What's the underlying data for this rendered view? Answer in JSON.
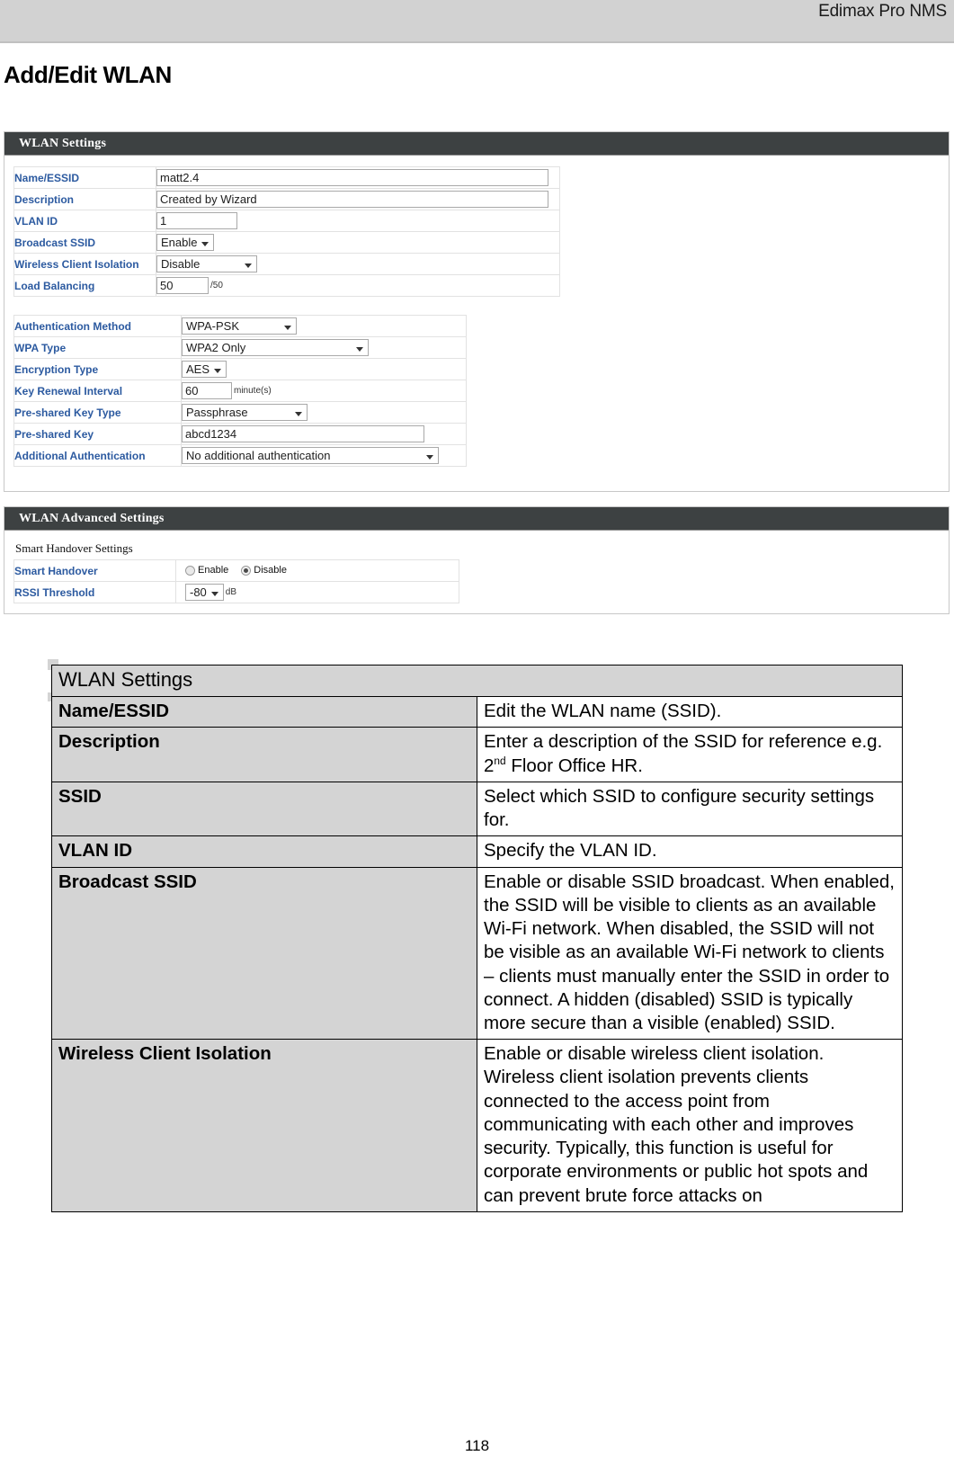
{
  "header": {
    "brand": "Edimax Pro NMS"
  },
  "page": {
    "title": "Add/Edit WLAN",
    "number": "118"
  },
  "wlan_settings_panel": {
    "title": "WLAN Settings",
    "basic_rows": [
      {
        "label": "Name/ESSID",
        "control": "text",
        "value": "matt2.4"
      },
      {
        "label": "Description",
        "control": "text",
        "value": "Created by Wizard"
      },
      {
        "label": "VLAN ID",
        "control": "text",
        "value": "1"
      },
      {
        "label": "Broadcast SSID",
        "control": "select",
        "value": "Enable"
      },
      {
        "label": "Wireless Client Isolation",
        "control": "select",
        "value": "Disable"
      },
      {
        "label": "Load Balancing",
        "control": "text",
        "value": "50",
        "suffix": "/50"
      }
    ],
    "security_rows": [
      {
        "label": "Authentication Method",
        "control": "select",
        "value": "WPA-PSK"
      },
      {
        "label": "WPA Type",
        "control": "select",
        "value": "WPA2 Only"
      },
      {
        "label": "Encryption Type",
        "control": "select",
        "value": "AES"
      },
      {
        "label": "Key Renewal Interval",
        "control": "text",
        "value": "60",
        "suffix": "minute(s)"
      },
      {
        "label": "Pre-shared Key Type",
        "control": "select",
        "value": "Passphrase"
      },
      {
        "label": "Pre-shared Key",
        "control": "text",
        "value": "abcd1234"
      },
      {
        "label": "Additional Authentication",
        "control": "select",
        "value": "No additional authentication"
      }
    ]
  },
  "wlan_advanced_panel": {
    "title": "WLAN Advanced Settings",
    "subhead": "Smart Handover Settings",
    "smart_handover": {
      "label": "Smart Handover",
      "option_enable": "Enable",
      "option_disable": "Disable",
      "selected": "Disable"
    },
    "rssi_threshold": {
      "label": "RSSI Threshold",
      "value": "-80",
      "unit": "dB"
    }
  },
  "doc_table": {
    "section_title": "WLAN Settings",
    "rows": [
      {
        "key": "Name/ESSID",
        "value": "Edit the WLAN name (SSID)."
      },
      {
        "key": "Description",
        "value_pre": "Enter a description of the SSID for reference e.g. 2",
        "value_sup": "nd",
        "value_post": " Floor Office HR."
      },
      {
        "key": "SSID",
        "value": "Select which SSID to configure security settings for."
      },
      {
        "key": "VLAN ID",
        "value": "Specify the VLAN ID."
      },
      {
        "key": "Broadcast SSID",
        "value": "Enable or disable SSID broadcast. When enabled, the SSID will be visible to clients as an available Wi-Fi network. When disabled, the SSID will not be visible as an available Wi-Fi network to clients – clients must manually enter the SSID in order to connect. A hidden (disabled) SSID is typically more secure than a visible (enabled) SSID."
      },
      {
        "key": "Wireless Client Isolation",
        "value": "Enable or disable wireless client isolation. Wireless client isolation prevents clients connected to the access point from communicating with each other and improves security. Typically, this function is useful for corporate environments or public hot spots and can prevent brute force attacks on"
      }
    ]
  },
  "colors": {
    "panel_bar": "#3d4142",
    "label_blue": "#2c5aa0",
    "header_band": "#d2d2d2",
    "doc_key_bg": "#d4d4d4"
  }
}
